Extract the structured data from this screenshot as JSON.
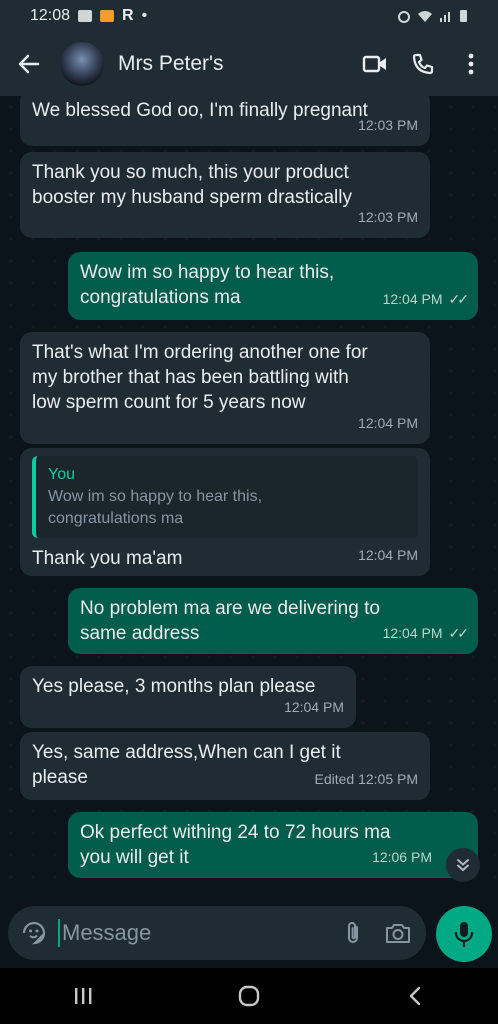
{
  "status_bar": {
    "time": "12:08",
    "app_letter": "R",
    "dot": "•"
  },
  "header": {
    "contact_name": "Mrs Peter's"
  },
  "messages": [
    {
      "text": "We blessed God oo, I'm finally pregnant",
      "time": "12:03 PM"
    },
    {
      "text": "Thank you so much, this your product\nbooster my husband sperm drastically",
      "time": "12:03 PM"
    },
    {
      "text": "Wow im so happy to hear this,\ncongratulations ma",
      "time": "12:04 PM"
    },
    {
      "text": "That's what I'm ordering another one for\nmy brother that has been battling with\nlow sperm count for 5 years now",
      "time": "12:04 PM"
    },
    {
      "quote_author": "You",
      "quote_text": "Wow im so happy to hear this,\ncongratulations ma",
      "text": "Thank you ma'am",
      "time": "12:04 PM"
    },
    {
      "text": "No problem ma are we delivering to\nsame address",
      "time": "12:04 PM"
    },
    {
      "text": "Yes please, 3 months plan please",
      "time": "12:04 PM"
    },
    {
      "text": "Yes, same address,When can I get it\nplease",
      "time": "Edited 12:05 PM"
    },
    {
      "text": "Ok perfect withing 24 to 72 hours ma\nyou will get it",
      "time": "12:06 PM"
    }
  ],
  "composer": {
    "placeholder": "Message"
  },
  "colors": {
    "accent": "#00a884",
    "outgoing_bubble": "#005c4b",
    "incoming_bubble": "#1f2c34",
    "background": "#0b141a"
  }
}
